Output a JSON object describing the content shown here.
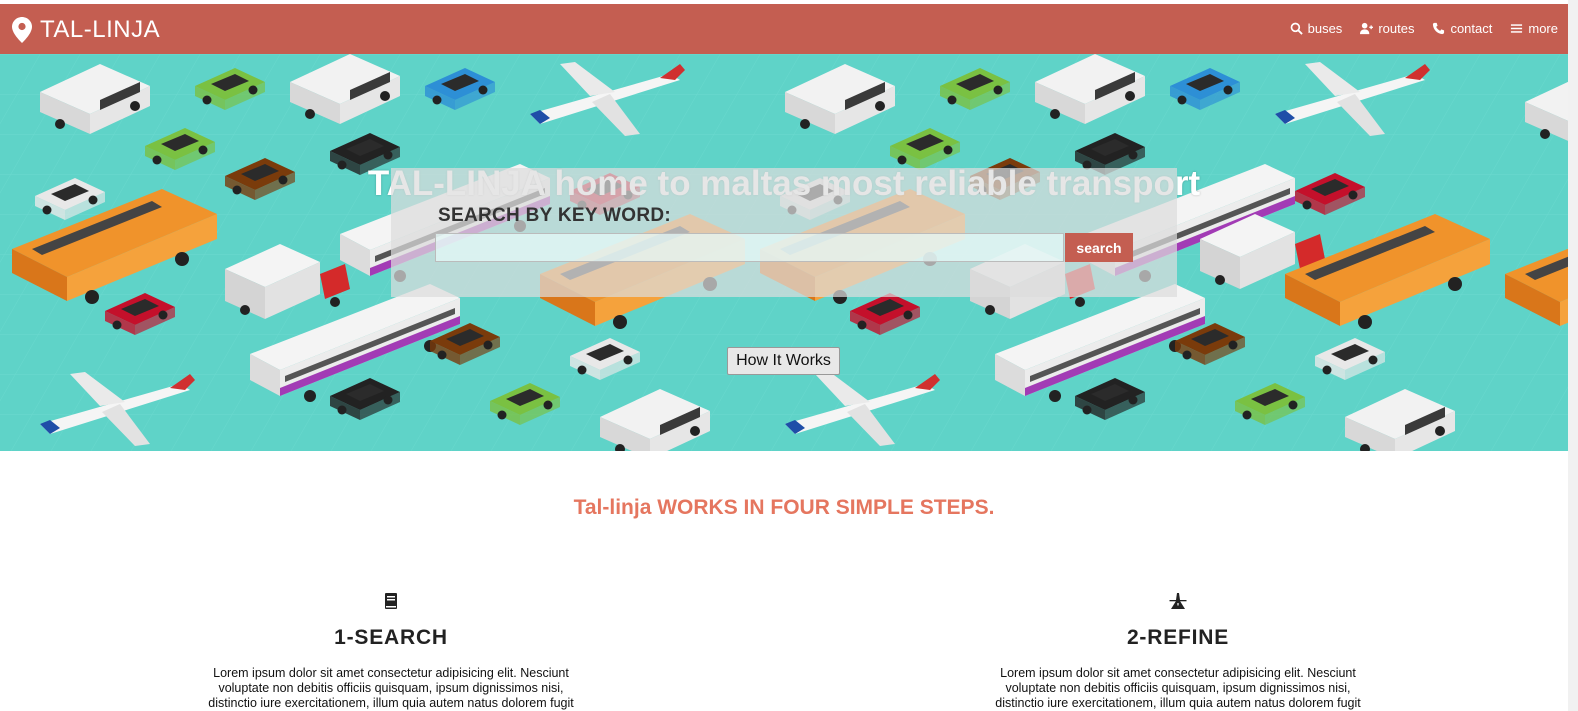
{
  "navbar": {
    "brand": "TAL-LINJA",
    "links": [
      {
        "label": "buses",
        "icon": "search-icon"
      },
      {
        "label": "routes",
        "icon": "user-plus-icon"
      },
      {
        "label": "contact",
        "icon": "phone-icon"
      },
      {
        "label": "more",
        "icon": "menu-icon"
      }
    ],
    "color": "#c45e51"
  },
  "hero": {
    "title": "TAL-LINJA home to maltas most reliable transport",
    "search_label": "SEARCH BY KEY WORD:",
    "search_value": "",
    "search_button": "search",
    "how_button": "How It Works",
    "background_color": "#5fd3c8"
  },
  "steps": {
    "heading": "Tal-linja WORKS IN FOUR SIMPLE STEPS.",
    "heading_color": "#e5765f",
    "items": [
      {
        "icon": "book-icon",
        "title": "1-SEARCH",
        "text": "Lorem ipsum dolor sit amet consectetur adipisicing elit. Nesciunt voluptate non debitis officiis quisquam, ipsum dignissimos nisi, distinctio iure exercitationem, illum quia autem natus dolorem fugit"
      },
      {
        "icon": "road-icon",
        "title": "2-REFINE",
        "text": "Lorem ipsum dolor sit amet consectetur adipisicing elit. Nesciunt voluptate non debitis officiis quisquam, ipsum dignissimos nisi, distinctio iure exercitationem, illum quia autem natus dolorem fugit"
      }
    ]
  }
}
